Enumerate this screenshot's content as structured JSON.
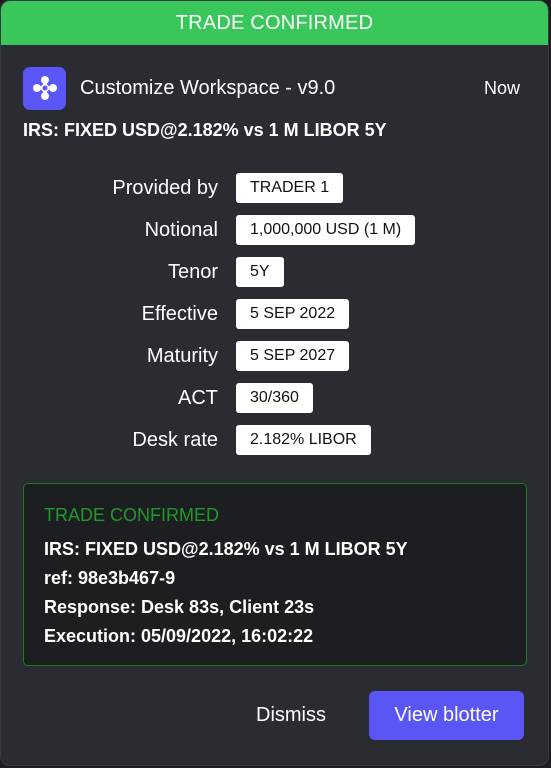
{
  "banner": {
    "text": "TRADE CONFIRMED"
  },
  "header": {
    "app_name": "Customize Workspace - v9.0",
    "time": "Now",
    "icon": "workspace-logo-icon"
  },
  "title": "IRS: FIXED USD@2.182% vs 1 M LIBOR 5Y",
  "fields": [
    {
      "label": "Provided by",
      "value": "TRADER 1"
    },
    {
      "label": "Notional",
      "value": "1,000,000 USD (1 M)"
    },
    {
      "label": "Tenor",
      "value": "5Y"
    },
    {
      "label": "Effective",
      "value": "5 SEP 2022"
    },
    {
      "label": "Maturity",
      "value": "5 SEP 2027"
    },
    {
      "label": "ACT",
      "value": "30/360"
    },
    {
      "label": "Desk rate",
      "value": "2.182% LIBOR"
    }
  ],
  "confirmation": {
    "title": "TRADE CONFIRMED",
    "lines": [
      "IRS: FIXED USD@2.182% vs 1 M LIBOR 5Y",
      "ref: 98e3b467-9",
      "Response: Desk 83s, Client 23s",
      "Execution: 05/09/2022, 16:02:22"
    ]
  },
  "actions": {
    "dismiss": "Dismiss",
    "primary": "View blotter"
  },
  "colors": {
    "banner": "#39c65a",
    "accent": "#5a55f5",
    "confirm_green": "#1e9a2a",
    "card_bg": "#2b2c31"
  }
}
